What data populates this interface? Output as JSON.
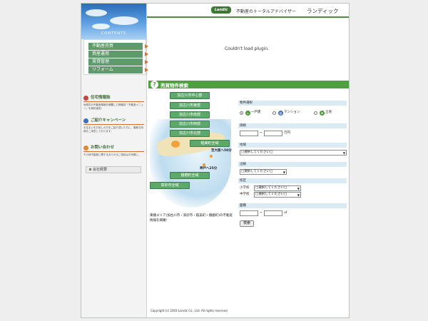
{
  "sidebar": {
    "contents_label": "CONTENTS",
    "menu": [
      {
        "label": "不動産売買"
      },
      {
        "label": "資産運用"
      },
      {
        "label": "賃貸管理"
      },
      {
        "label": "リフォーム"
      }
    ],
    "info_blocks": [
      {
        "title": "住宅情報誌",
        "body": "地域内の不動産情報を網羅した情報誌「不動産メニュー」を無料進呈!"
      },
      {
        "title": "ご紹介キャンペーン",
        "body": "お住まいをお探しの方をご紹介頂いた方に、素敵な特典をご用意しております。"
      },
      {
        "title": "お問い合わせ",
        "body": "その他不動産に関するあらゆるご相談はお気軽に。"
      }
    ],
    "company_label": "会社概要"
  },
  "header": {
    "logo_text": "Landic",
    "tagline": "不動産のトータルアドバイザー",
    "brand": "ランディック"
  },
  "plugin_message": "Couldn't load plugin.",
  "search": {
    "bar_title": "売買物件検索",
    "map_areas": [
      {
        "label": "加古川市中心部"
      },
      {
        "label": "加古川市東部"
      },
      {
        "label": "加古川市南部"
      },
      {
        "label": "加古川市西部"
      },
      {
        "label": "加古川市北部"
      },
      {
        "label": "稲美町全域"
      },
      {
        "label": "播磨町全域"
      },
      {
        "label": "高砂市全域"
      }
    ],
    "city_labels": {
      "osaka": "至大阪へ50分",
      "kobe": "神戸へ25分"
    },
    "map_description": "東播エリア(加古川市・高砂市・稲美町・播磨町)の不動産情報を網羅!",
    "form": {
      "type_label": "物件選択",
      "types": [
        {
          "label": "一戸建",
          "selected": true
        },
        {
          "label": "マンション",
          "selected": false
        },
        {
          "label": "土地",
          "selected": false
        }
      ],
      "price_label": "価格",
      "price_separator": "~",
      "price_unit": "万円",
      "area_label": "地域",
      "area_select": "□選択してください□",
      "line_label": "沿線",
      "line_select": "□選択してください□",
      "school_label": "校区",
      "elementary_label": "小学校",
      "elementary_select": "□選択してください□",
      "junior_label": "中学校",
      "junior_select": "□選択してください□",
      "size_label": "面積",
      "size_separator": "~",
      "size_unit": "㎡",
      "search_button": "検索"
    }
  },
  "footer": {
    "copyright": "Copyright (c) 2003 Landic Co., Ltd. All rights reserved"
  },
  "colors": {
    "accent_green": "#4f9e3f",
    "menu_green": "#5f9a6a",
    "orange": "#e47022",
    "field_blue": "#d9ecf6"
  }
}
